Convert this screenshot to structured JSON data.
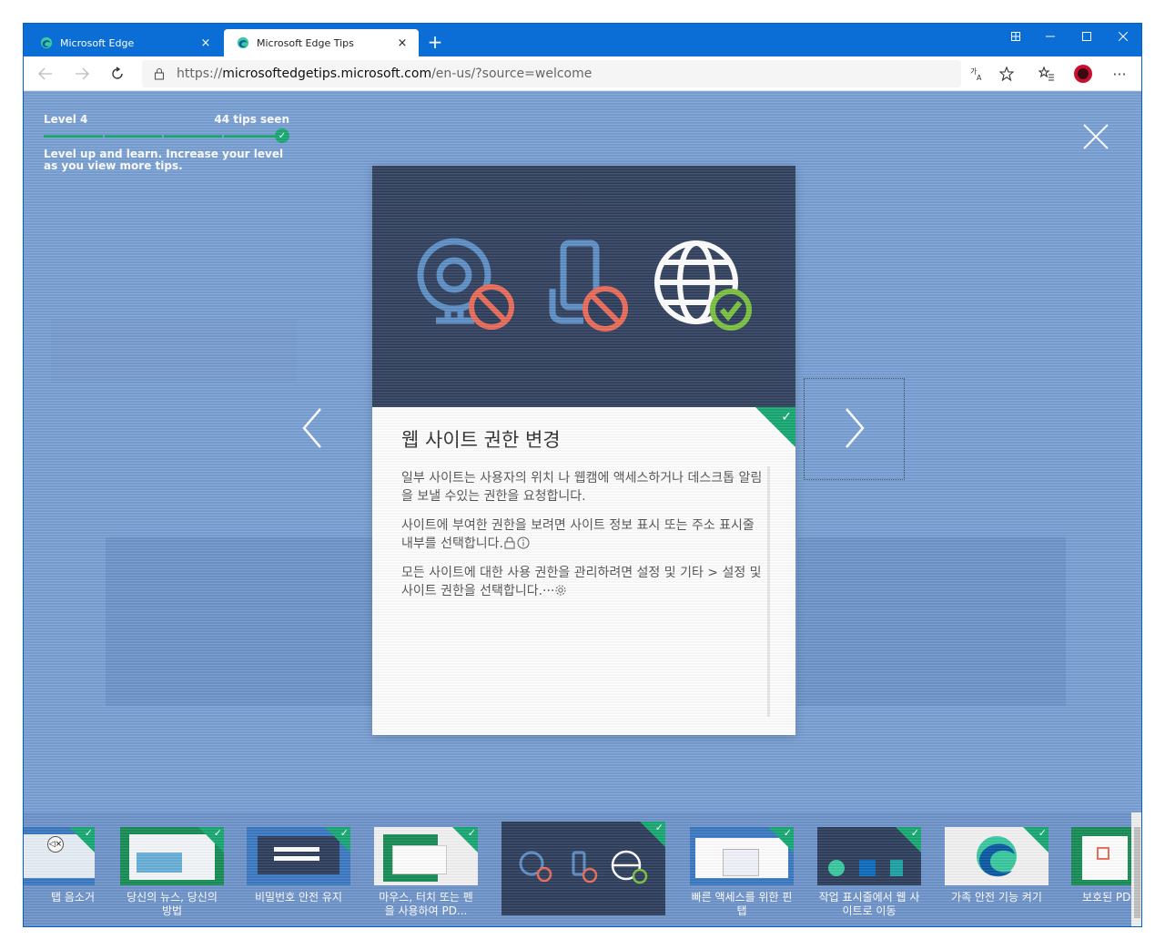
{
  "browser": {
    "tabs": [
      {
        "title": "Microsoft Edge",
        "active": false
      },
      {
        "title": "Microsoft Edge Tips",
        "active": true
      }
    ],
    "new_tab_symbol": "+",
    "tab_close_symbol": "×",
    "url_prefix": "https://",
    "url_host": "microsoftedgetips.microsoft.com",
    "url_path": "/en-us/?source=welcome",
    "more_symbol": "···"
  },
  "level": {
    "name": "Level 4",
    "tips_seen": "44 tips seen",
    "description": "Level up and learn. Increase your level as you view more tips."
  },
  "card": {
    "title": "웹 사이트 권한 변경",
    "paragraphs": [
      "일부 사이트는 사용자의 위치 나 웹캠에 액세스하거나 데스크톱 알림을 보낼 수있는 권한을 요청합니다.",
      "사이트에 부여한 권한을 보려면 사이트 정보 표시 또는 주소 표시줄 내부를 선택합니다.",
      "모든 사이트에 대한 사용 권한을 관리하려면 설정 및 기타 > 설정 및 사이트 권한을 선택합니다.···"
    ]
  },
  "tips": [
    {
      "label": "탭 음소거"
    },
    {
      "label": "당신의 뉴스, 당신의 방법"
    },
    {
      "label": "비밀번호 안전 유지"
    },
    {
      "label": "마우스, 터치 또는 펜을 사용하여 PD..."
    },
    {
      "label": ""
    },
    {
      "label": "빠른 액세스를 위한 핀 탭"
    },
    {
      "label": "작업 표시줄에서 웹 사이트로 이동"
    },
    {
      "label": "가족 안전 기능 켜기"
    },
    {
      "label": "보호된 PD"
    }
  ],
  "colors": {
    "titlebar": "#0a6ed6",
    "overlay": "#7aa0d4",
    "card_hero": "#2f3f5e",
    "seen_green": "#19a974"
  }
}
